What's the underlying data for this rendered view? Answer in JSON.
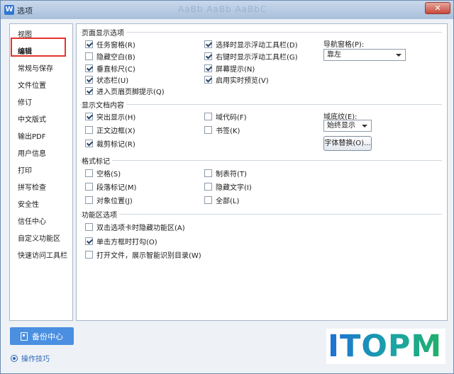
{
  "window": {
    "title": "选项",
    "app_icon": "W",
    "faint_title": "AaBb AaBb AaBbC",
    "close_label": "✕"
  },
  "sidebar": {
    "items": [
      {
        "label": "视图"
      },
      {
        "label": "编辑",
        "selected": true
      },
      {
        "label": "常规与保存"
      },
      {
        "label": "文件位置"
      },
      {
        "label": "修订"
      },
      {
        "label": "中文版式"
      },
      {
        "label": "输出PDF"
      },
      {
        "label": "用户信息"
      },
      {
        "label": "打印"
      },
      {
        "label": "拼写检查"
      },
      {
        "label": "安全性"
      },
      {
        "label": "信任中心"
      },
      {
        "label": "自定义功能区"
      },
      {
        "label": "快速访问工具栏"
      }
    ]
  },
  "page_display": {
    "title": "页面显示选项",
    "left": [
      {
        "label": "任务窗格(R)",
        "checked": true
      },
      {
        "label": "隐藏空白(B)",
        "checked": false
      },
      {
        "label": "垂直标尺(C)",
        "checked": true
      },
      {
        "label": "状态栏(U)",
        "checked": true
      },
      {
        "label": "进入页眉页脚提示(Q)",
        "checked": true
      }
    ],
    "right": [
      {
        "label": "选择时显示浮动工具栏(D)",
        "checked": true
      },
      {
        "label": "右键时显示浮动工具栏(G)",
        "checked": true
      },
      {
        "label": "屏幕提示(N)",
        "checked": true
      },
      {
        "label": "启用实时预览(V)",
        "checked": true
      }
    ],
    "nav_pane_label": "导航窗格(P):",
    "nav_pane_value": "靠左"
  },
  "doc_content": {
    "title": "显示文档内容",
    "left": [
      {
        "label": "突出显示(H)",
        "checked": true
      },
      {
        "label": "正文边框(X)",
        "checked": false
      },
      {
        "label": "裁剪标记(R)",
        "checked": true
      }
    ],
    "right": [
      {
        "label": "域代码(F)",
        "checked": false
      },
      {
        "label": "书签(K)",
        "checked": false
      }
    ],
    "field_shading_label": "域底纹(E):",
    "field_shading_value": "始终显示",
    "font_replace_label": "字体替换(O)..."
  },
  "format_marks": {
    "title": "格式标记",
    "left": [
      {
        "label": "空格(S)",
        "checked": false
      },
      {
        "label": "段落标记(M)",
        "checked": false
      },
      {
        "label": "对象位置(J)",
        "checked": false
      }
    ],
    "right": [
      {
        "label": "制表符(T)",
        "checked": false
      },
      {
        "label": "隐藏文字(I)",
        "checked": false
      },
      {
        "label": "全部(L)",
        "checked": false
      }
    ]
  },
  "feature_options": {
    "title": "功能区选项",
    "items": [
      {
        "label": "双击选项卡时隐藏功能区(A)",
        "checked": false
      },
      {
        "label": "单击方框时打勾(O)",
        "checked": true
      },
      {
        "label": "打开文件，展示智能识别目录(W)",
        "checked": false
      }
    ]
  },
  "footer": {
    "backup_label": "备份中心",
    "tips_label": "操作技巧",
    "watermark": "ITOPM"
  }
}
